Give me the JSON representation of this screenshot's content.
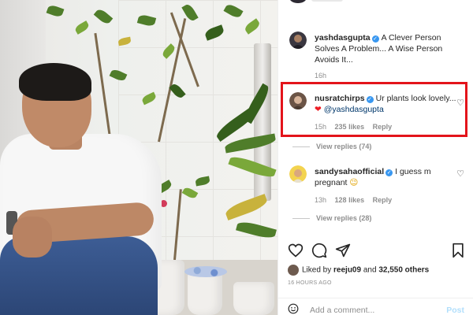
{
  "comments": [
    {
      "username": "yashdasgupta",
      "text": "A Clever Person Solves A Problem... A Wise Person Avoids It...",
      "time": "16h"
    },
    {
      "username": "nusratchirps",
      "text": "Ur plants look lovely...",
      "emoji": "❤",
      "mention": "@yashdasgupta",
      "time": "15h",
      "likes": "235 likes",
      "reply": "Reply",
      "view_replies": "View replies (74)"
    },
    {
      "username": "sandysahaofficial",
      "text": "I guess m pregnant",
      "emoji": "😉",
      "time": "13h",
      "likes": "128 likes",
      "reply": "Reply",
      "view_replies": "View replies (28)"
    }
  ],
  "liked_by": {
    "prefix": "Liked by",
    "user": "reeju09",
    "conj": "and",
    "others": "32,550 others"
  },
  "posted_ago": "16 HOURS AGO",
  "add_comment": {
    "placeholder": "Add a comment...",
    "post_label": "Post"
  },
  "colors": {
    "highlight": "#e3141b",
    "verified": "#3897f0",
    "mention": "#00376b",
    "post_disabled": "#b2dffc"
  },
  "icons": [
    "heart-icon",
    "comment-icon",
    "share-icon",
    "bookmark-icon",
    "emoji-icon",
    "verified-badge-icon"
  ]
}
